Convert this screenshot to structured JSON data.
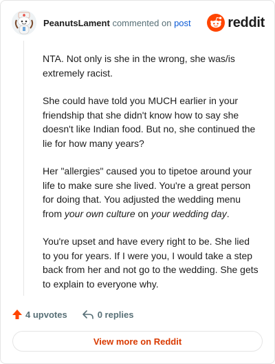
{
  "header": {
    "author": "PeanutsLament",
    "action_text": "commented on",
    "post_link": "post",
    "brand_name": "reddit",
    "brand_color": "#ff4500"
  },
  "comment": {
    "p1": "NTA. Not only is she in the wrong, she was/is extremely racist.",
    "p2": "She could have told you MUCH earlier in your friendship that she didn't know how to say she doesn't like Indian food. But no, she continued the lie for how many years?",
    "p3_a": "Her \"allergies\" caused you to tipetoe around your life to make sure she lived. You're a great person for doing that. You adjusted the wedding menu from ",
    "p3_em1": "your own culture",
    "p3_b": " on ",
    "p3_em2": "your wedding day",
    "p3_c": ".",
    "p4": "You're upset and have every right to be. She lied to you for years. If I were you, I would take a step back from her and not go to the wedding. She gets to explain to everyone why."
  },
  "actions": {
    "upvotes": "4 upvotes",
    "replies": "0 replies",
    "upvote_icon": "arrow-up-icon",
    "reply_icon": "reply-arrow-icon",
    "upvote_color": "#ff4500"
  },
  "footer": {
    "view_more_label": "View more on Reddit"
  }
}
